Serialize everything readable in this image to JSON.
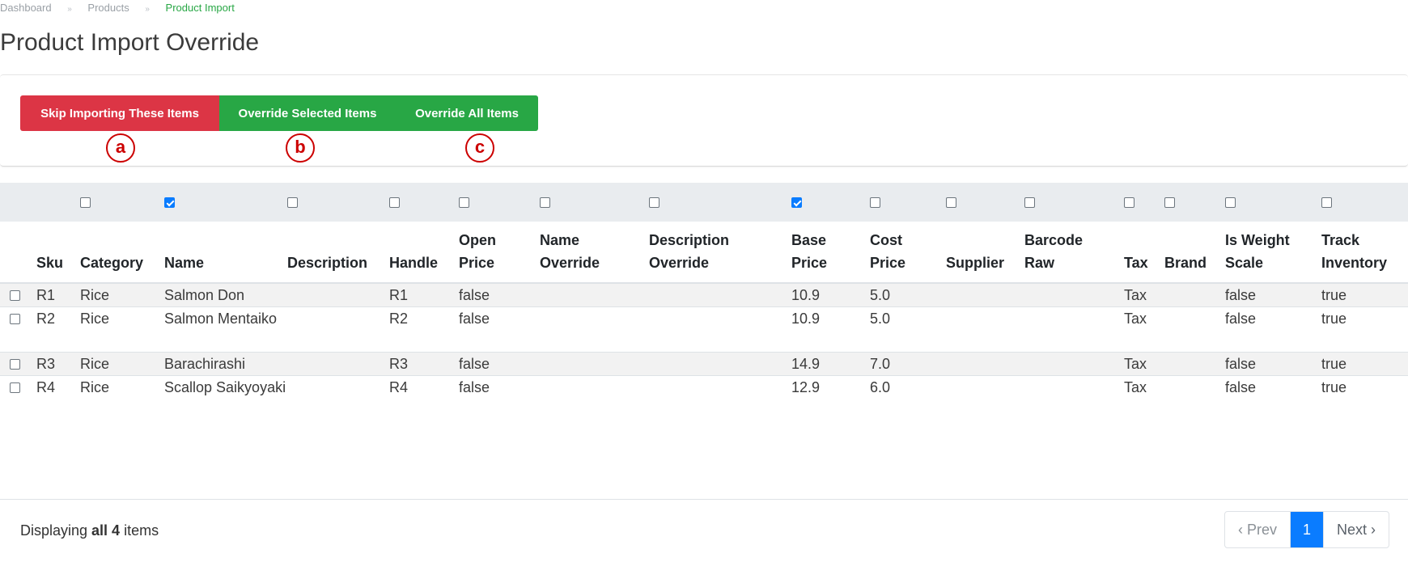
{
  "breadcrumb": {
    "items": [
      "Dashboard",
      "Products"
    ],
    "current": "Product Import",
    "separator": "»"
  },
  "page": {
    "title": "Product Import Override"
  },
  "actions": {
    "skip_label": "Skip Importing These Items",
    "override_selected_label": "Override Selected Items",
    "override_all_label": "Override All Items",
    "colors": {
      "danger": "#dc3545",
      "success": "#28a745"
    }
  },
  "markers": [
    "a",
    "b",
    "c"
  ],
  "table": {
    "columns": [
      "Sku",
      "Category",
      "Name",
      "Description",
      "Handle",
      "Open Price",
      "Name Override",
      "Description Override",
      "Base Price",
      "Cost Price",
      "Supplier",
      "Barcode Raw",
      "Tax",
      "Brand",
      "Is Weight Scale",
      "Track Inventory"
    ],
    "column_header_lines": [
      [
        "Sku"
      ],
      [
        "Category"
      ],
      [
        "Name"
      ],
      [
        "Description"
      ],
      [
        "Handle"
      ],
      [
        "Open",
        "Price"
      ],
      [
        "Name",
        "Override"
      ],
      [
        "Description",
        "Override"
      ],
      [
        "Base",
        "Price"
      ],
      [
        "Cost",
        "Price"
      ],
      [
        "Supplier"
      ],
      [
        "Barcode",
        "Raw"
      ],
      [
        "Tax"
      ],
      [
        "Brand"
      ],
      [
        "Is Weight",
        "Scale"
      ],
      [
        "Track",
        "Inventory"
      ]
    ],
    "column_checked": [
      false,
      true,
      false,
      false,
      false,
      false,
      false,
      true,
      false,
      false,
      false,
      false,
      false,
      false,
      false
    ],
    "rows": [
      {
        "checked": false,
        "cells": [
          "R1",
          "Rice",
          "Salmon Don",
          "",
          "R1",
          "false",
          "",
          "",
          "10.9",
          "5.0",
          "",
          "",
          "Tax",
          "",
          "false",
          "true"
        ]
      },
      {
        "checked": false,
        "cells": [
          "R2",
          "Rice",
          "Salmon Mentaiko",
          "",
          "R2",
          "false",
          "",
          "",
          "10.9",
          "5.0",
          "",
          "",
          "Tax",
          "",
          "false",
          "true"
        ]
      },
      {
        "checked": false,
        "cells": [
          "R3",
          "Rice",
          "Barachirashi",
          "",
          "R3",
          "false",
          "",
          "",
          "14.9",
          "7.0",
          "",
          "",
          "Tax",
          "",
          "false",
          "true"
        ]
      },
      {
        "checked": false,
        "cells": [
          "R4",
          "Rice",
          "Scallop Saikyoyaki",
          "",
          "R4",
          "false",
          "",
          "",
          "12.9",
          "6.0",
          "",
          "",
          "Tax",
          "",
          "false",
          "true"
        ]
      }
    ]
  },
  "footer": {
    "prefix": "Displaying ",
    "emph": "all 4",
    "suffix": " items",
    "pager": {
      "prev": "‹ Prev",
      "current": "1",
      "next": "Next ›"
    },
    "accent": "#0a7cff"
  }
}
